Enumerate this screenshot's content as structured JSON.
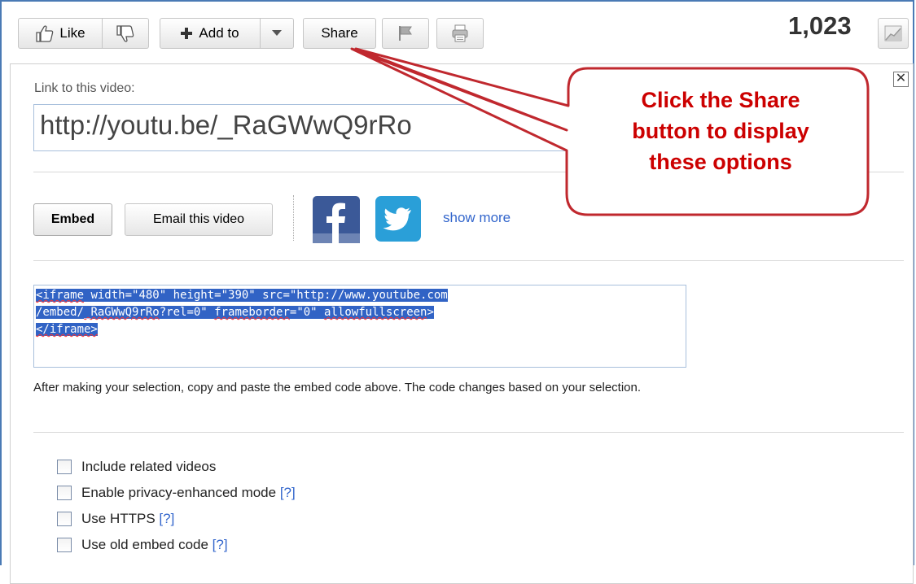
{
  "toolbar": {
    "like_label": "Like",
    "add_to_label": "Add to",
    "share_label": "Share",
    "view_count": "1,023"
  },
  "share_panel": {
    "link_label": "Link to this video:",
    "link_url": "http://youtu.be/_RaGWwQ9rRo",
    "close_symbol": "✕",
    "embed_button": "Embed",
    "email_button": "Email this video",
    "show_more": "show more",
    "embed_code": {
      "line1_a": "<iframe",
      "line1_b": " width=\"480\" height=\"390\" src=\"http://www.youtube.com",
      "line2_a": "/embed/",
      "line2_b": "_RaGWwQ9rRo",
      "line2_c": "?rel=0\" ",
      "line2_d": "frameborder",
      "line2_e": "=\"0\" ",
      "line2_f": "allowfullscreen",
      "line2_g": ">",
      "line3": "</iframe>"
    },
    "help_text": "After making your selection, copy and paste the embed code above. The code changes based on your selection.",
    "options": [
      {
        "label": "Include related videos",
        "help": ""
      },
      {
        "label": "Enable privacy-enhanced mode ",
        "help": "[?]"
      },
      {
        "label": "Use HTTPS ",
        "help": "[?]"
      },
      {
        "label": "Use old embed code ",
        "help": "[?]"
      }
    ]
  },
  "callout": {
    "line1": "Click the Share",
    "line2": "button to display",
    "line3": "these options",
    "color": "#cc0000"
  },
  "icons": [
    "thumbs-up-icon",
    "thumbs-down-icon",
    "plus-icon",
    "dropdown-arrow-icon",
    "flag-icon",
    "print-icon",
    "stats-icon",
    "facebook-icon",
    "twitter-icon"
  ]
}
